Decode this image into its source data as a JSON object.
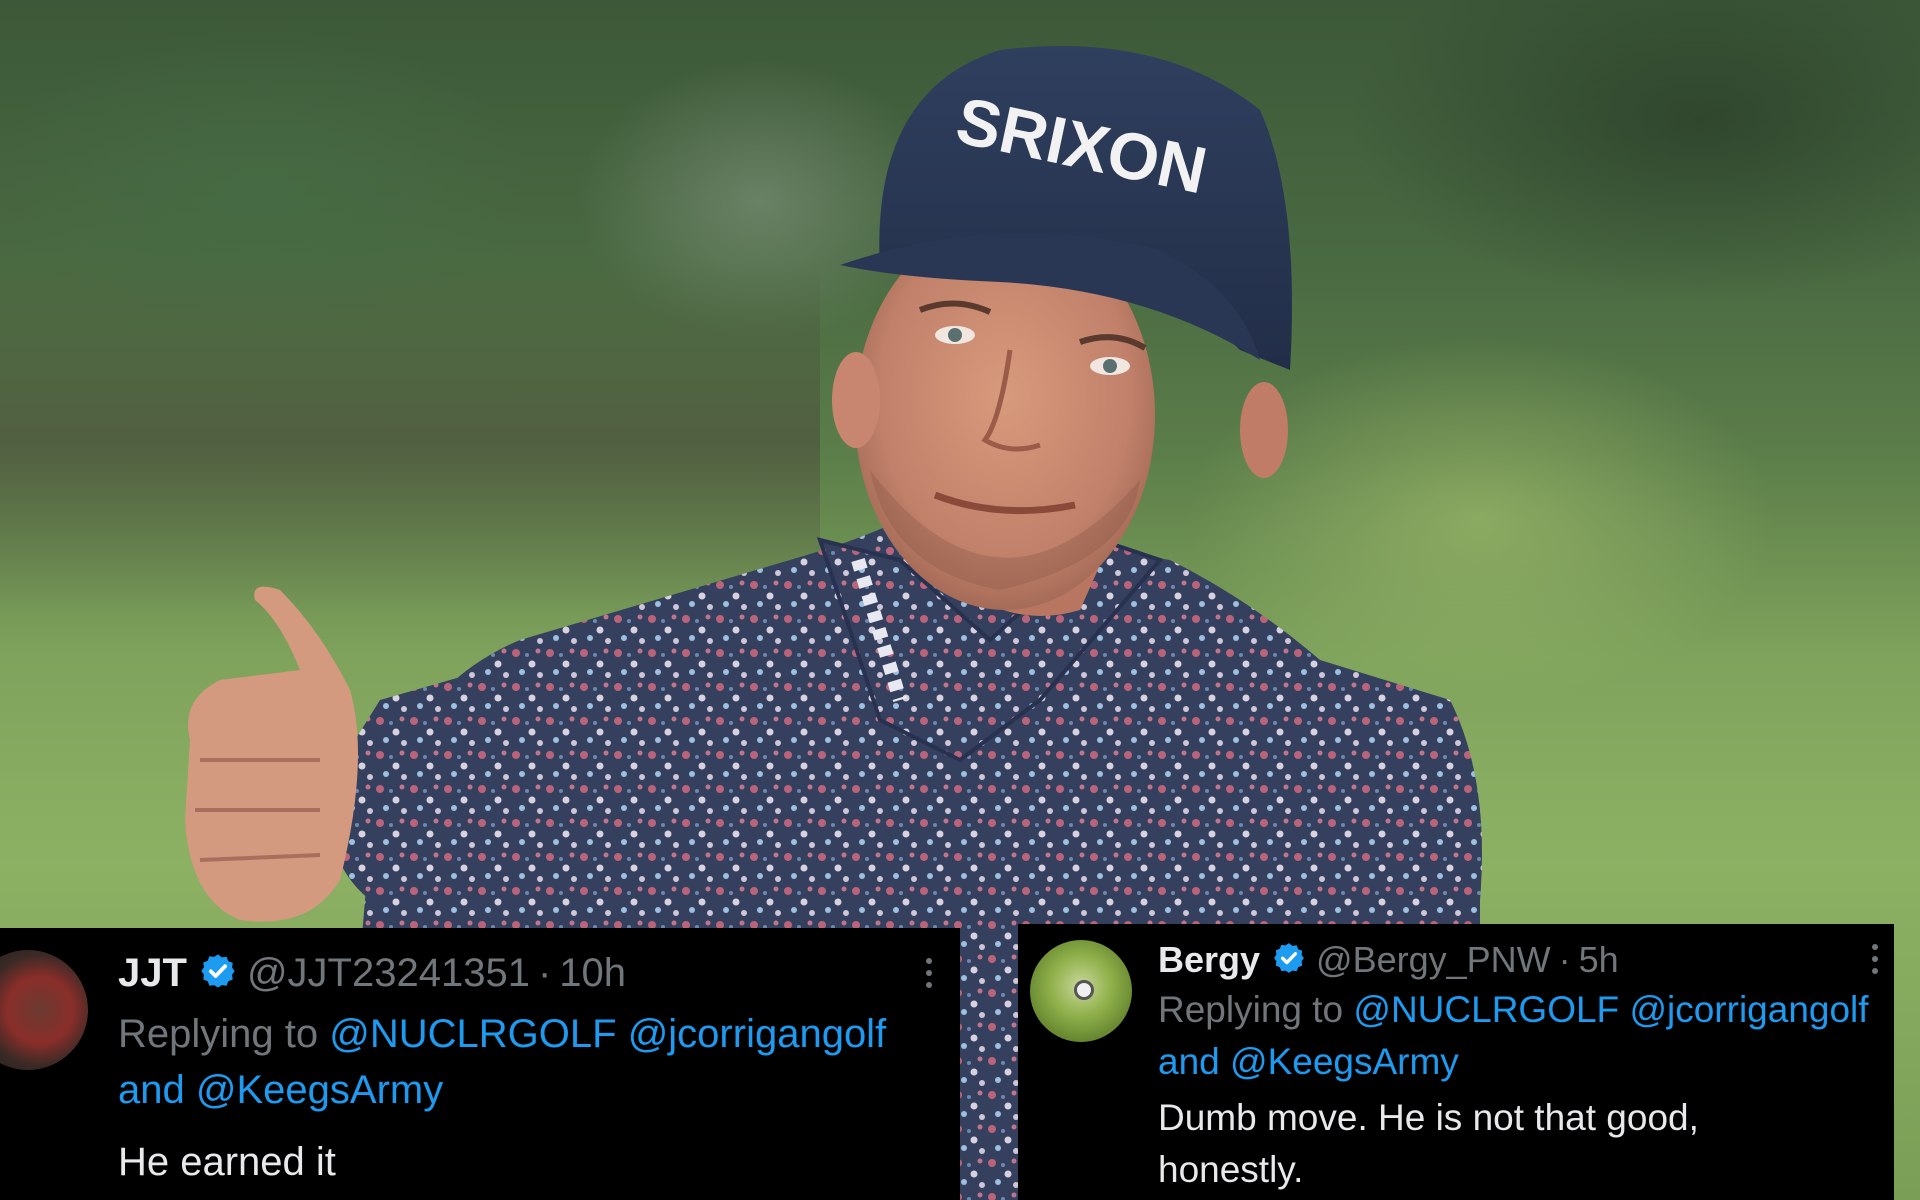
{
  "photo": {
    "cap_brand_text": "SRIXON",
    "colors": {
      "cap": "#273650",
      "shirt": "#34405e",
      "grass": "#8db163",
      "skin": "#c98b6e"
    }
  },
  "tweets": [
    {
      "display_name": "JJT",
      "handle": "@JJT23241351",
      "separator": "·",
      "time": "10h",
      "replying_prefix": "Replying to",
      "mention_1": "@NUCLRGOLF",
      "mention_2": "@jcorrigangolf",
      "conjunction": "and",
      "mention_3": "@KeegsArmy",
      "text": "He earned it",
      "verified": true
    },
    {
      "display_name": "Bergy",
      "handle": "@Bergy_PNW",
      "separator": "·",
      "time": "5h",
      "replying_prefix": "Replying to",
      "mention_1": "@NUCLRGOLF",
      "mention_2": "@jcorrigangolf",
      "conjunction": "and",
      "mention_3": "@KeegsArmy",
      "text_line_1": "Dumb move. He is not that good,",
      "text_line_2": "honestly.",
      "verified": true
    }
  ],
  "theme": {
    "card_bg": "#000000",
    "text_primary": "#e7e9ea",
    "text_secondary": "#71767b",
    "link": "#1d9bf0",
    "verified_badge": "#1d9bf0"
  }
}
